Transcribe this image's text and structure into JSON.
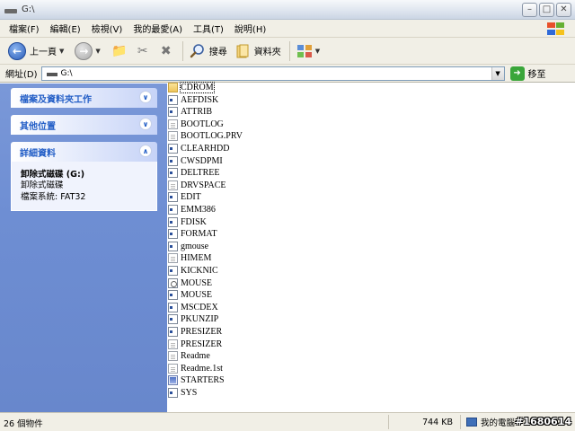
{
  "window": {
    "title": "G:\\"
  },
  "menu": [
    "檔案(F)",
    "編輯(E)",
    "檢視(V)",
    "我的最愛(A)",
    "工具(T)",
    "說明(H)"
  ],
  "toolbar": {
    "back_label": "上一頁",
    "search_label": "搜尋",
    "folders_label": "資料夾"
  },
  "address": {
    "label": "網址(D)",
    "value": "G:\\",
    "go_label": "移至"
  },
  "taskpane": {
    "file_tasks": "檔案及資料夾工作",
    "other_places": "其他位置",
    "details_title": "詳細資料",
    "details_name": "卸除式磁碟 (G:)",
    "details_type": "卸除式磁碟",
    "details_fs": "檔案系統: FAT32"
  },
  "files": [
    {
      "name": "CDROM",
      "type": "folder"
    },
    {
      "name": "AEFDISK",
      "type": "exe"
    },
    {
      "name": "ATTRIB",
      "type": "exe"
    },
    {
      "name": "BOOTLOG",
      "type": "doc"
    },
    {
      "name": "BOOTLOG.PRV",
      "type": "doc"
    },
    {
      "name": "CLEARHDD",
      "type": "exe"
    },
    {
      "name": "CWSDPMI",
      "type": "exe"
    },
    {
      "name": "DELTREE",
      "type": "exe"
    },
    {
      "name": "DRVSPACE",
      "type": "doc"
    },
    {
      "name": "EDIT",
      "type": "exe"
    },
    {
      "name": "EMM386",
      "type": "exe"
    },
    {
      "name": "FDISK",
      "type": "exe"
    },
    {
      "name": "FORMAT",
      "type": "exe"
    },
    {
      "name": "gmouse",
      "type": "exe"
    },
    {
      "name": "HIMEM",
      "type": "doc"
    },
    {
      "name": "KICKNIC",
      "type": "exe"
    },
    {
      "name": "MOUSE",
      "type": "com"
    },
    {
      "name": "MOUSE",
      "type": "exe"
    },
    {
      "name": "MSCDEX",
      "type": "exe"
    },
    {
      "name": "PKUNZIP",
      "type": "exe"
    },
    {
      "name": "PRESIZER",
      "type": "exe"
    },
    {
      "name": "PRESIZER",
      "type": "doc"
    },
    {
      "name": "Readme",
      "type": "doc"
    },
    {
      "name": "Readme.1st",
      "type": "doc"
    },
    {
      "name": "STARTERS",
      "type": "bat"
    },
    {
      "name": "SYS",
      "type": "exe"
    }
  ],
  "status": {
    "objects": "26 個物件",
    "size": "744 KB",
    "location": "我的電腦",
    "watermark": "#1680614"
  },
  "colors": {
    "taskpane_bg": "#7a98d8",
    "panel_head_text": "#215dc6"
  },
  "icons": [
    "drive-icon",
    "back-icon",
    "forward-icon",
    "up-folder-icon",
    "search-icon",
    "folders-icon",
    "views-icon",
    "go-icon",
    "computer-icon"
  ]
}
